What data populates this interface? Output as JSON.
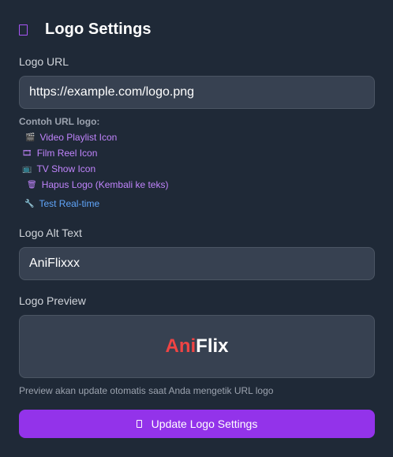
{
  "header": {
    "title": "Logo Settings",
    "icon": "square-outline-icon",
    "accent": "#a855f7"
  },
  "logo_url": {
    "label": "Logo URL",
    "value": "https://example.com/logo.png"
  },
  "examples": {
    "title": "Contoh URL logo:",
    "links": [
      {
        "icon": "🎬",
        "icon_name": "clapperboard-icon",
        "label": "Video Playlist Icon"
      },
      {
        "icon": "🎞",
        "icon_name": "film-reel-icon",
        "label": "Film Reel Icon"
      },
      {
        "icon": "📺",
        "icon_name": "tv-icon",
        "label": "TV Show Icon"
      },
      {
        "icon": "🗑",
        "icon_name": "trash-icon",
        "label": "Hapus Logo (Kembali ke teks)"
      }
    ],
    "test": {
      "icon": "🔧",
      "icon_name": "wrench-icon",
      "label": "Test Real-time"
    }
  },
  "alt_text": {
    "label": "Logo Alt Text",
    "value": "AniFlixxx"
  },
  "preview": {
    "label": "Logo Preview",
    "brand_part1": "Ani",
    "brand_part2": "Flix",
    "brand_color1": "#ef4444",
    "brand_color2": "#ffffff",
    "hint": "Preview akan update otomatis saat Anda mengetik URL logo"
  },
  "actions": {
    "update_label": "Update Logo Settings",
    "update_icon": "square-outline-icon",
    "button_color": "#9333ea"
  }
}
